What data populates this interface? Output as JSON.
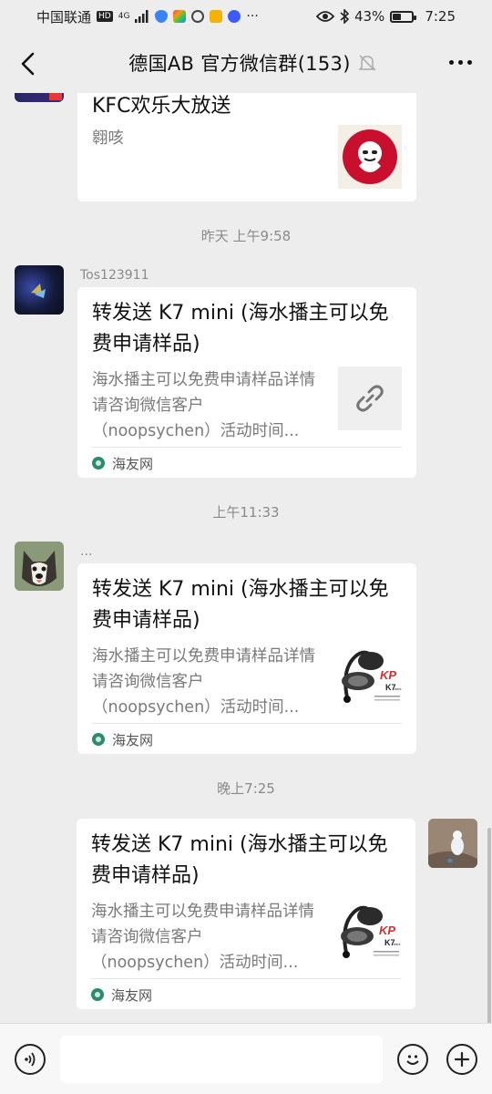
{
  "status": {
    "carrier": "中国联通",
    "hd": "HD",
    "signal": "4G",
    "battery": "43%",
    "battery_level": 0.43,
    "time": "7:25"
  },
  "nav": {
    "title": "德国AB  官方微信群(153)"
  },
  "messages": {
    "m0": {
      "title": "KFC欢乐大放送",
      "desc": "翱咳"
    },
    "ts1": "昨天 上午9:58",
    "m1": {
      "sender": "Tos123911",
      "title": "转发送 K7 mini (海水播主可以免费申请样品)",
      "desc": "海水播主可以免费申请样品详情请咨询微信客户（noopsychen）活动时间...",
      "source": "海友网"
    },
    "ts2": "上午11:33",
    "m2": {
      "sender": "...",
      "title": "转发送 K7 mini (海水播主可以免费申请样品)",
      "desc": "海水播主可以免费申请样品详情请咨询微信客户（noopsychen）活动时间...",
      "source": "海友网"
    },
    "ts3": "晚上7:25",
    "m3": {
      "title": "转发送 K7 mini (海水播主可以免费申请样品)",
      "desc": "海水播主可以免费申请样品详情请咨询微信客户（noopsychen）活动时间...",
      "source": "海友网"
    }
  },
  "product_thumb": {
    "brand": "K7",
    "logo": "KP",
    "sub": "mini"
  },
  "input": {
    "placeholder": ""
  },
  "icons": {
    "back": "chevron-left-icon",
    "mute": "bell-off-icon",
    "more": "more-dots-icon",
    "voice": "voice-icon",
    "emoji": "emoji-icon",
    "plus": "plus-icon",
    "link": "link-icon"
  }
}
